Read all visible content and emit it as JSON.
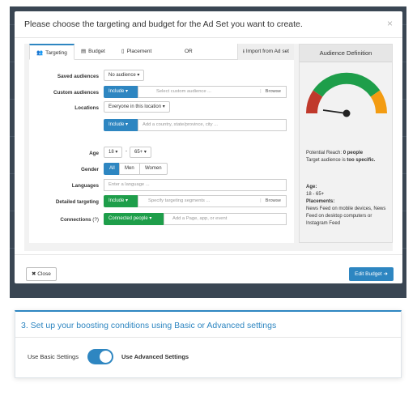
{
  "modal": {
    "title": "Please choose the targeting and budget for the Ad Set you want to create.",
    "close_glyph": "×",
    "tabs": [
      {
        "label": "Targeting",
        "icon": "users-icon",
        "active": true
      },
      {
        "label": "Budget",
        "icon": "money-icon",
        "active": false
      },
      {
        "label": "Placement",
        "icon": "mobile-icon",
        "active": false
      },
      {
        "label": "OR",
        "icon": "",
        "active": false
      }
    ],
    "import_label": "Import from Ad set",
    "form": {
      "saved_audiences": {
        "label": "Saved audiences",
        "value": "No audience"
      },
      "custom_audiences": {
        "label": "Custom audiences",
        "mode": "Include",
        "placeholder": "Select custom audience ...",
        "browse": "Browse"
      },
      "locations": {
        "label": "Locations",
        "value": "Everyone in this location",
        "mode": "Include",
        "placeholder": "Add a country, state/province, city ..."
      },
      "age": {
        "label": "Age",
        "min": "18",
        "max": "65+",
        "sep": "-"
      },
      "gender": {
        "label": "Gender",
        "options": [
          "All",
          "Men",
          "Women"
        ],
        "selected": "All"
      },
      "languages": {
        "label": "Languages",
        "placeholder": "Enter a language ..."
      },
      "detailed_targeting": {
        "label": "Detailed targeting",
        "mode": "Include",
        "placeholder": "Specify targeting segments ...",
        "browse": "Browse"
      },
      "connections": {
        "label": "Connections",
        "help": "(?)",
        "value": "Connected people",
        "placeholder": "Add a Page, app, or event"
      }
    },
    "audience": {
      "title": "Audience Definition",
      "reach_label": "Potential Reach:",
      "reach_value": "0 people",
      "target_prefix": "Target audience is",
      "target_value": "too specific.",
      "age_label": "Age:",
      "age_value": "18 - 65+",
      "placements_label": "Placements:",
      "placements_value": "News Feed on mobile devices, News Feed on desktop computers or Instagram Feed",
      "gauge_colors": [
        "#c0392b",
        "#1e9e4a",
        "#f39c12"
      ]
    },
    "footer": {
      "close_label": "Close",
      "edit_label": "Edit Budget"
    }
  },
  "settings_card": {
    "title": "3. Set up your boosting conditions using Basic or Advanced settings",
    "basic_label": "Use Basic Settings",
    "advanced_label": "Use Advanced Settings",
    "toggle_on": true
  },
  "colors": {
    "accent": "#2e86c1",
    "green": "#1e9e4a",
    "backdrop": "#3a4653"
  }
}
